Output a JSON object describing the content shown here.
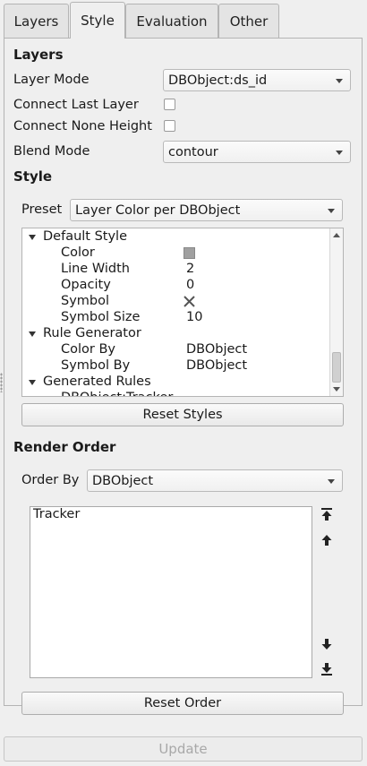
{
  "tabs": [
    "Layers",
    "Style",
    "Evaluation",
    "Other"
  ],
  "active_tab": "Style",
  "layers_section": {
    "title": "Layers",
    "layer_mode_label": "Layer Mode",
    "layer_mode_value": "DBObject:ds_id",
    "connect_last_layer_label": "Connect Last Layer",
    "connect_last_layer_checked": false,
    "connect_none_height_label": "Connect None Height",
    "connect_none_height_checked": false,
    "blend_mode_label": "Blend Mode",
    "blend_mode_value": "contour"
  },
  "style_section": {
    "title": "Style",
    "preset_label": "Preset",
    "preset_value": "Layer Color per DBObject",
    "tree": {
      "default_style": "Default Style",
      "color_label": "Color",
      "color_swatch": "#a0a0a0",
      "line_width_label": "Line Width",
      "line_width_value": "2",
      "opacity_label": "Opacity",
      "opacity_value": "0",
      "symbol_label": "Symbol",
      "symbol_icon": "x-cross-icon",
      "symbol_size_label": "Symbol Size",
      "symbol_size_value": "10",
      "rule_generator": "Rule Generator",
      "color_by_label": "Color By",
      "color_by_value": "DBObject",
      "symbol_by_label": "Symbol By",
      "symbol_by_value": "DBObject",
      "generated_rules": "Generated Rules",
      "generated_child": "DBObject:Tracker"
    },
    "reset_styles_label": "Reset Styles"
  },
  "render_order_section": {
    "title": "Render Order",
    "order_by_label": "Order By",
    "order_by_value": "DBObject",
    "items": [
      "Tracker"
    ],
    "reset_order_label": "Reset Order"
  },
  "update_label": "Update"
}
